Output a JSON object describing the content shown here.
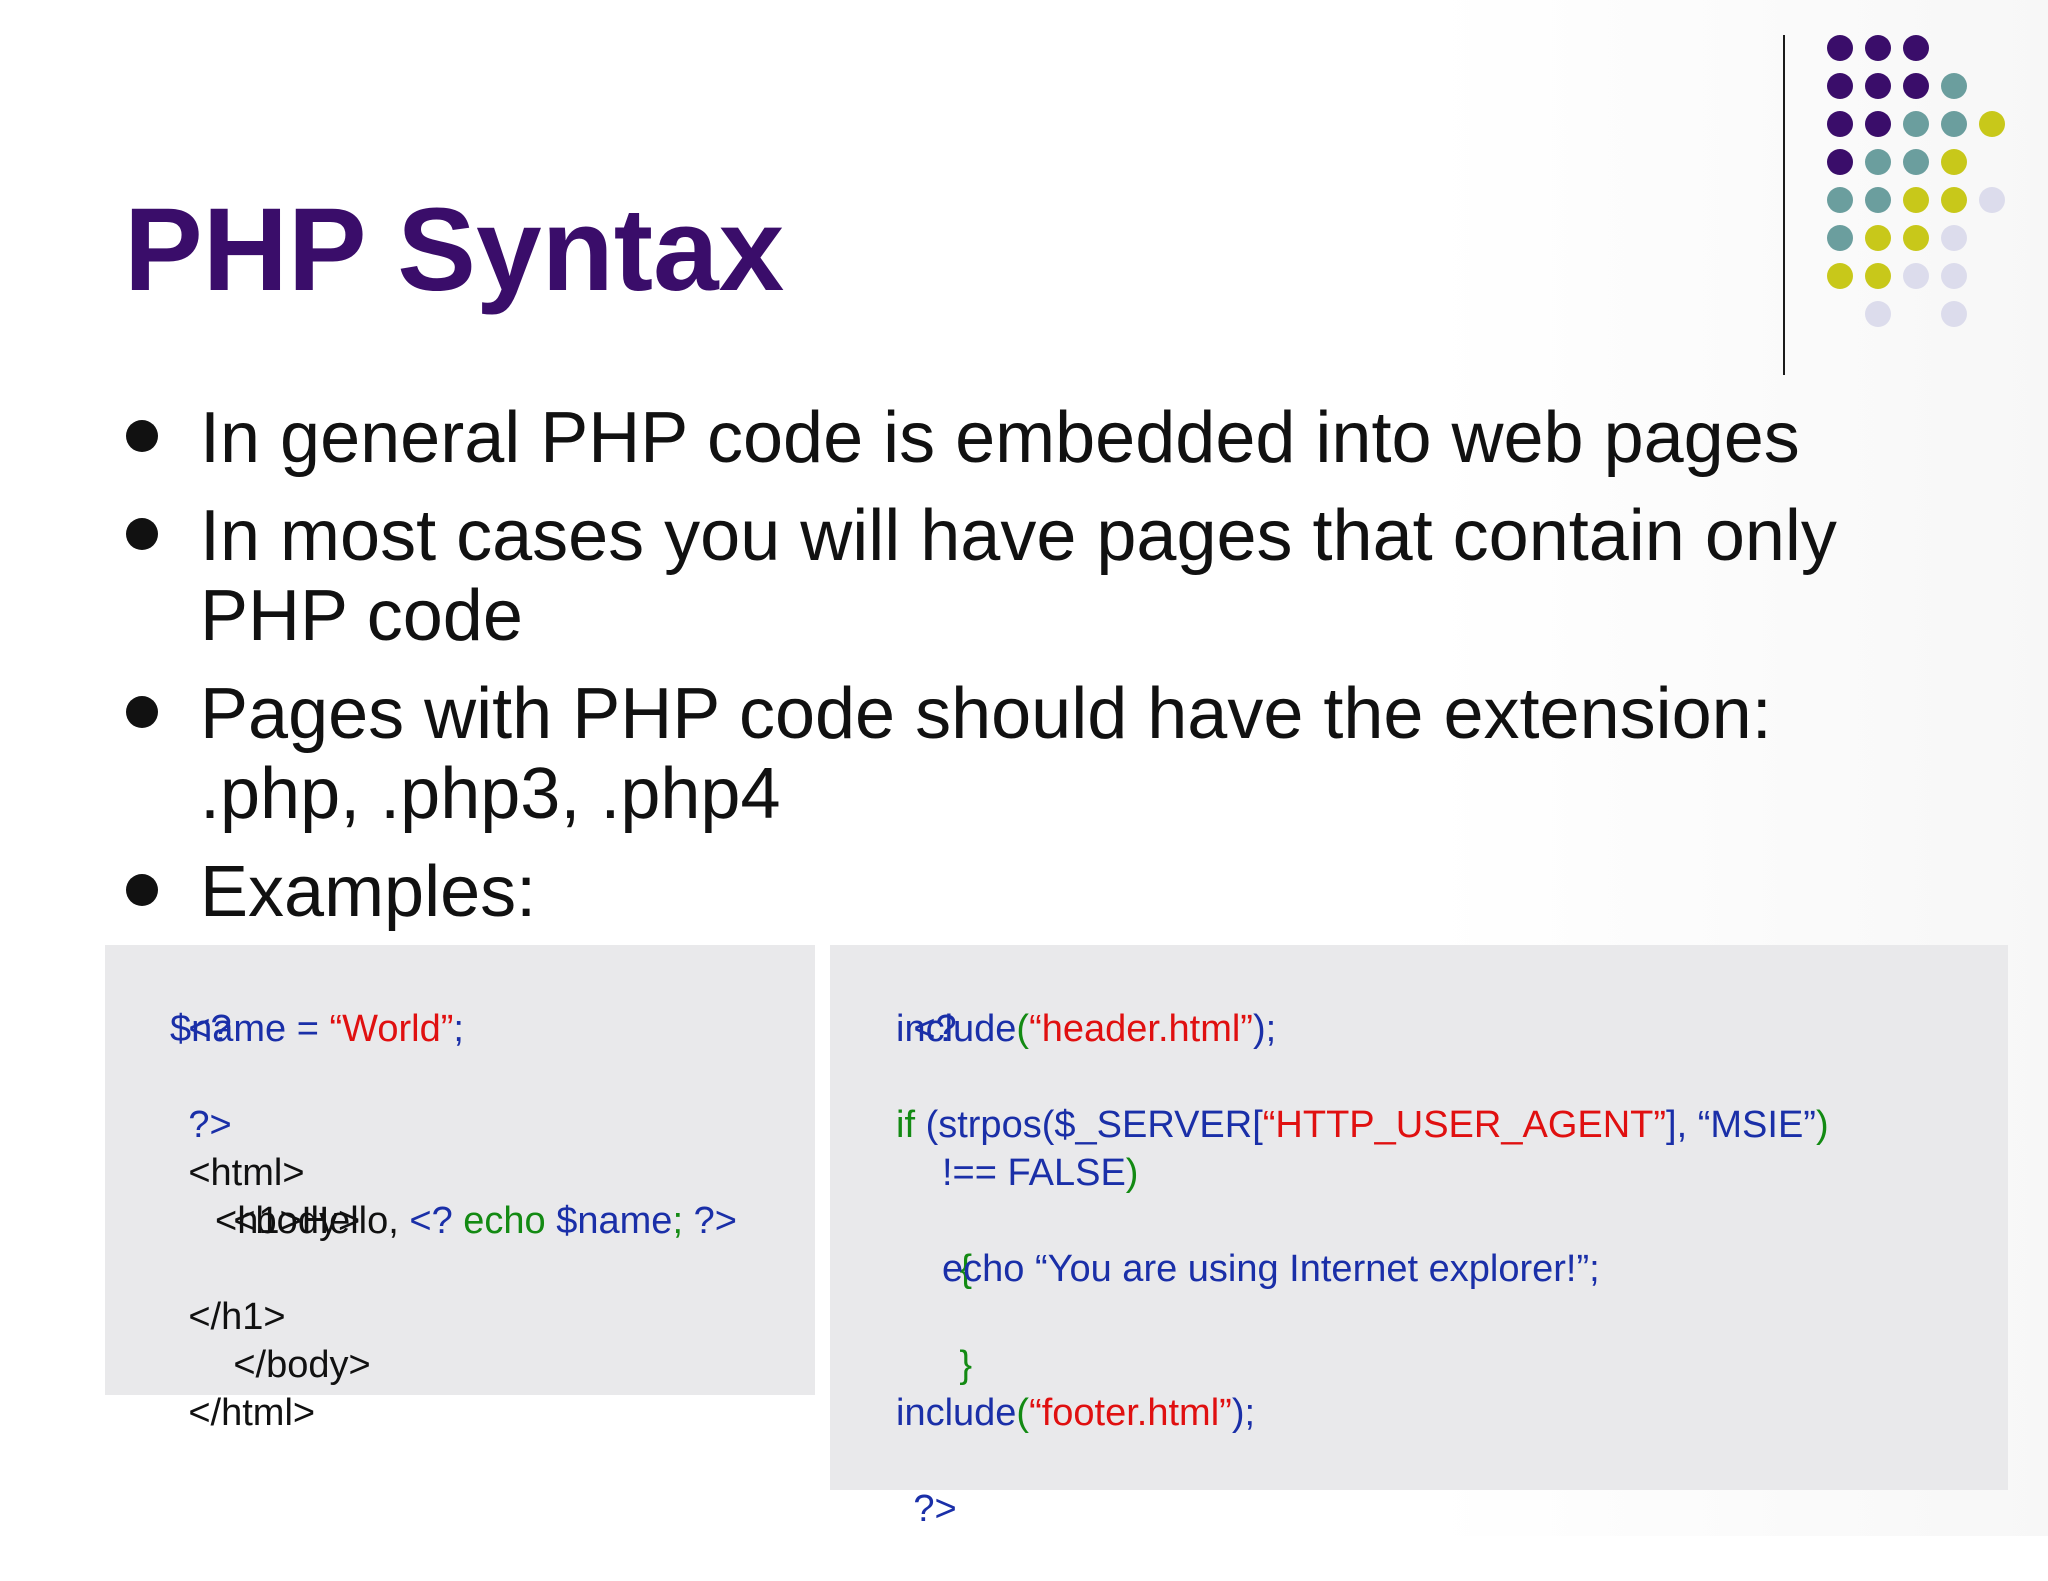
{
  "slide": {
    "title": "PHP Syntax",
    "colors": {
      "title": "#3a0d6a",
      "dot_purple": "#3a0d6a",
      "dot_teal": "#6b9e9e",
      "dot_yellow": "#c8c81a",
      "dot_lavender": "#dcdcec",
      "code_bg": "#e9e9eb",
      "code_blue": "#1a2fa8",
      "code_red": "#e01010",
      "code_green": "#138a13"
    },
    "bullets": [
      "In general PHP code is embedded into web pages",
      "In most cases you will have pages that contain only PHP code",
      "Pages with PHP code should have the extension: .php, .php3, .php4",
      "Examples:"
    ]
  },
  "example1": {
    "l1": "<?",
    "l2_var": "$name",
    "l2_eq": " = ",
    "l2_str": "“World”",
    "l2_end": ";",
    "l3": "?>",
    "l4": "<html>",
    "l5": "<body>",
    "l6_tag": "<h1>Hello, ",
    "l6_open": "<? ",
    "l6_echo": "echo ",
    "l6_var": "$name",
    "l6_semi": "; ",
    "l6_close": "?>",
    "l7": "</h1>",
    "l8": "</body>",
    "l9": "</html>"
  },
  "example2": {
    "l1": "<?",
    "l2_fn": "include",
    "l2_open": "(",
    "l2_str": "“header.html”",
    "l2_end": ");",
    "l3_if": "if ",
    "l3_fn": "(strpos(",
    "l3_var": "$_SERVER[",
    "l3_str": "“HTTP_USER_AGENT”",
    "l3_close": "], ",
    "l3_str2": "“MSIE”",
    "l3_end": ")",
    "l4_op": "!== FALSE",
    "l4_end": ")",
    "l5": "{",
    "l6_echo": "echo ",
    "l6_str": "“You are using Internet explorer!”;",
    "l7": "}",
    "l8_fn": "include",
    "l8_open": "(",
    "l8_str": "“footer.html”",
    "l8_end": ");",
    "l9": "?>"
  }
}
